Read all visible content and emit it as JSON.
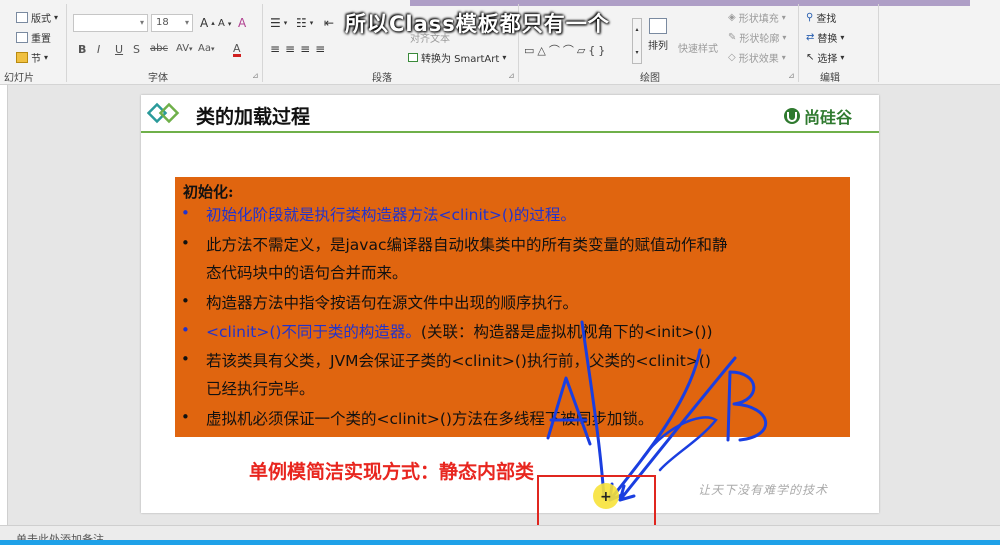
{
  "ribbon": {
    "slides_group": {
      "label": "幻灯片",
      "layout": "版式",
      "reset": "重置",
      "section": "节"
    },
    "font_group": {
      "label": "字体",
      "font_size": "18",
      "grow": "A",
      "shrink": "A",
      "clear": "A",
      "bold": "B",
      "italic": "I",
      "underline": "U",
      "strike": "S",
      "spacing": "abc",
      "case": "Aa",
      "color": "A"
    },
    "paragraph_group": {
      "label": "段落",
      "align_text": "对齐文本",
      "smartart": "转换为 SmartArt"
    },
    "drawing_group": {
      "label": "绘图",
      "arrange": "排列",
      "quick_styles": "快速样式",
      "shape_fill": "形状填充",
      "shape_outline": "形状轮廓",
      "shape_effects": "形状效果"
    },
    "editing_group": {
      "label": "编辑",
      "find": "查找",
      "replace": "替换",
      "select": "选择"
    }
  },
  "overlay_subtitle": "所以Class模板都只有一个",
  "slide": {
    "title": "类的加载过程",
    "brand": "尚硅谷",
    "heading": "初始化:",
    "bullets": [
      {
        "lines": [
          "初始化阶段就是执行类构造器方法<clinit>()的过程。"
        ]
      },
      {
        "lines": [
          "此方法不需定义，是javac编译器自动收集类中的所有类变量的赋值动作和静",
          "态代码块中的语句合并而来。"
        ]
      },
      {
        "lines": [
          "构造器方法中指令按语句在源文件中出现的顺序执行。"
        ]
      },
      {
        "lines": [
          "<clinit>()不同于类的构造器。(关联：构造器是虚拟机视角下的<init>())"
        ]
      },
      {
        "lines": [
          "若该类具有父类，JVM会保证子类的<clinit>()执行前，父类的<clinit>()",
          "已经执行完毕。"
        ]
      },
      {
        "lines": [
          "虚拟机必须保证一个类的<clinit>()方法在多线程下被同步加锁。"
        ]
      }
    ],
    "bullet4_part1": "<clinit>()不同于类的构造器。",
    "bullet4_part2": "(关联：构造器是虚拟机视角下的<init>())",
    "caption": "单例模简洁实现方式：静态内部类",
    "motto": "让天下没有难学的技术"
  },
  "annotations": {
    "letter_a": "A",
    "letter_b": "B",
    "cursor_glyph": "+"
  },
  "notes_placeholder": "单击此处添加备注",
  "colors": {
    "content_box": "#e0650f",
    "blue_text": "#2233cc",
    "caption_red": "#e8261f",
    "pen_blue": "#1a3ee0",
    "highlight_red": "#e0261f",
    "progress_blue": "#1fa1e8"
  }
}
